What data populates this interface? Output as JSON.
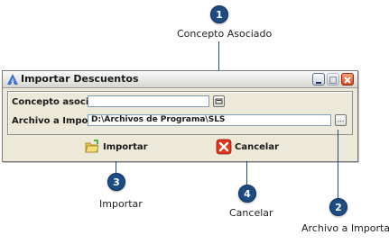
{
  "window": {
    "title": "Importar Descuentos",
    "controls": {
      "minimize": "minimize-icon",
      "maximize": "maximize-icon",
      "close": "close-icon"
    }
  },
  "form": {
    "concepto_label": "Concepto asociado:",
    "concepto_value": "",
    "archivo_label": "Archivo a Importar:",
    "archivo_value": "D:\\Archivos de Programa\\SLS",
    "browse_label": "..."
  },
  "actions": {
    "importar_label": "Importar",
    "cancelar_label": "Cancelar"
  },
  "callouts": [
    {
      "number": "1",
      "text": "Concepto Asociado"
    },
    {
      "number": "2",
      "text": "Archivo a Importar"
    },
    {
      "number": "3",
      "text": "Importar"
    },
    {
      "number": "4",
      "text": "Cancelar"
    }
  ],
  "colors": {
    "callout": "#1d4b84",
    "window_bg": "#ece9d8",
    "close_button": "#d9481d"
  }
}
